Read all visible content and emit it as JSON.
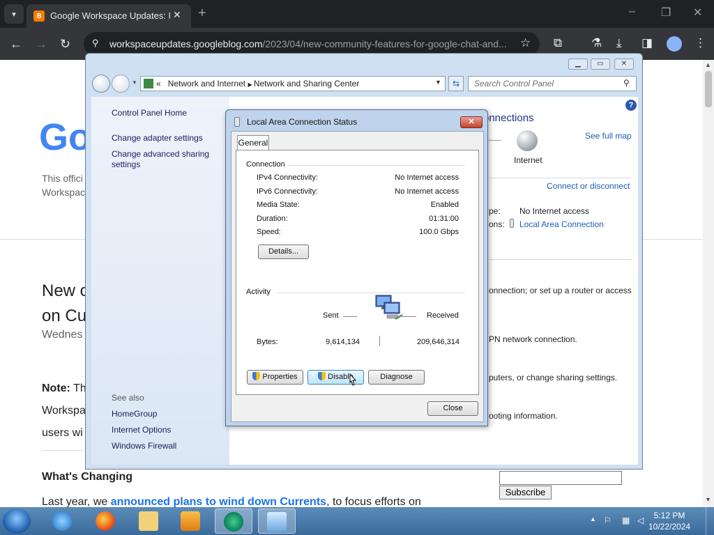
{
  "browser": {
    "tab_title": "Google Workspace Updates: N",
    "url_host": "workspaceupdates.googleblog.com",
    "url_path": "/2023/04/new-community-features-for-google-chat-and...",
    "tab_favicon_letter": "B",
    "window_min": "–",
    "window_max": "❐",
    "window_close": "✕",
    "new_tab": "+"
  },
  "webpage": {
    "logo_text": "Go",
    "blog_desc": "This offici Workspac",
    "post_title": "New c on Cu",
    "post_date": "Wednes",
    "note_label": "Note:",
    "note_text": " Th Workspa users wi",
    "whats_changing": "What's Changing",
    "last_year_prefix": "Last year, we ",
    "last_year_link": "announced plans to wind down Currents",
    "last_year_suffix": ", to focus efforts on",
    "subscribe_label": "Subscribe"
  },
  "control_panel": {
    "address": {
      "prefix": "«",
      "crumb1": "Network and Internet",
      "crumb2": "Network and Sharing Center"
    },
    "search_placeholder": "Search Control Panel",
    "sidebar": {
      "home": "Control Panel Home",
      "adapter": "Change adapter settings",
      "advanced": "Change advanced sharing settings",
      "see_also": "See also",
      "homegroup": "HomeGroup",
      "internet_options": "Internet Options",
      "firewall": "Windows Firewall"
    },
    "main": {
      "heading": "onnections",
      "see_full_map": "See full map",
      "internet": "Internet",
      "connect_disconnect": "Connect or disconnect",
      "access_type_label": "pe:",
      "access_type_value": "No Internet access",
      "connections_label": "ons:",
      "connections_value": "Local Area Connection",
      "task1": "onnection; or set up a router or access",
      "task2": "PN network connection.",
      "task3": "puters, or change sharing settings.",
      "task4": "ooting information."
    }
  },
  "dialog": {
    "title": "Local Area Connection Status",
    "tab_general": "General",
    "connection_group": "Connection",
    "rows": [
      {
        "label": "IPv4 Connectivity:",
        "value": "No Internet access"
      },
      {
        "label": "IPv6 Connectivity:",
        "value": "No Internet access"
      },
      {
        "label": "Media State:",
        "value": "Enabled"
      },
      {
        "label": "Duration:",
        "value": "01:31:00"
      },
      {
        "label": "Speed:",
        "value": "100.0 Gbps"
      }
    ],
    "details_btn": "Details...",
    "activity_group": "Activity",
    "sent_label": "Sent",
    "received_label": "Received",
    "bytes_label": "Bytes:",
    "bytes_sent": "9,614,134",
    "bytes_received": "209,646,314",
    "properties_btn": "Properties",
    "disable_btn": "Disable",
    "diagnose_btn": "Diagnose",
    "close_btn": "Close"
  },
  "taskbar": {
    "time": "5:12 PM",
    "date": "10/22/2024"
  },
  "colors": {
    "chrome_dark": "#202124",
    "link_blue": "#1a73e8",
    "win7_taskbar": "#3a6a9a",
    "dialog_close_red": "#c2422b"
  }
}
